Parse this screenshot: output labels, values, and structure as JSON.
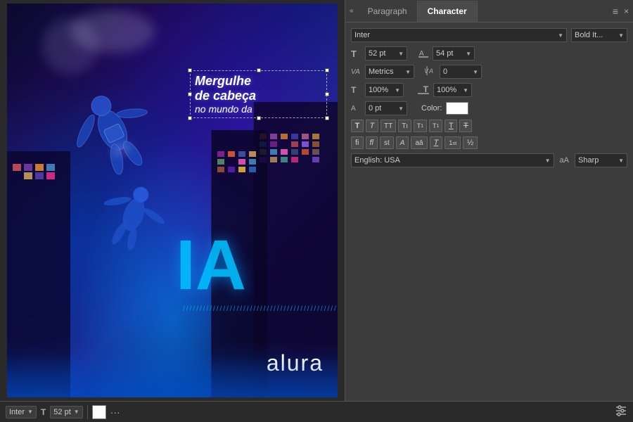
{
  "panel": {
    "tabs": [
      {
        "label": "Paragraph",
        "active": false
      },
      {
        "label": "Character",
        "active": true
      }
    ],
    "collapse_icon": "«",
    "close_icon": "×",
    "menu_icon": "≡"
  },
  "character": {
    "font_name": "Inter",
    "font_style": "Bold It...",
    "font_size": "52 pt",
    "leading": "54 pt",
    "kerning_label": "VA",
    "kerning_type": "Metrics",
    "tracking_label": "VA",
    "tracking_value": "0",
    "scale_h_label": "T",
    "scale_h": "100%",
    "scale_v_label": "T",
    "scale_v": "100%",
    "baseline_label": "A",
    "baseline": "0 pt",
    "color_label": "Color:",
    "language": "English: USA",
    "aa_label": "aA",
    "antialiasing": "Sharp",
    "typo_buttons": [
      {
        "label": "T",
        "style": "normal",
        "title": "Regular"
      },
      {
        "label": "T",
        "style": "italic",
        "title": "Italic"
      },
      {
        "label": "TT",
        "style": "normal",
        "title": "All Caps"
      },
      {
        "label": "Tt",
        "style": "normal",
        "title": "Small Caps"
      },
      {
        "label": "T",
        "style": "super",
        "title": "Superscript"
      },
      {
        "label": "T",
        "style": "sub",
        "title": "Subscript"
      },
      {
        "label": "T",
        "style": "underline",
        "title": "Underline"
      },
      {
        "label": "T̶",
        "style": "strike",
        "title": "Strikethrough"
      }
    ],
    "liga_buttons": [
      {
        "label": "fi",
        "title": "Ligatures"
      },
      {
        "label": "ﬂ",
        "title": "Discretionary Ligatures"
      },
      {
        "label": "st",
        "title": "Swash"
      },
      {
        "label": "A",
        "title": "Stylistic Alternates"
      },
      {
        "label": "aā",
        "title": "Ordinals"
      },
      {
        "label": "T",
        "style": "frac",
        "title": "Fractions"
      },
      {
        "label": "1st",
        "title": "Ordinals2"
      },
      {
        "label": "½",
        "title": "Fractions2"
      }
    ]
  },
  "canvas": {
    "text_line1": "Mergulhe",
    "text_line2": "de cabeça",
    "text_line3": "no mundo da",
    "ia_text": "IA",
    "slash_decoration": "//////////////////////////////////////////////////////////////////////////////",
    "alura_text": "alura"
  },
  "toolbar": {
    "font": "Inter",
    "size": "52 pt",
    "dots": "···",
    "sliders": "⚙"
  }
}
